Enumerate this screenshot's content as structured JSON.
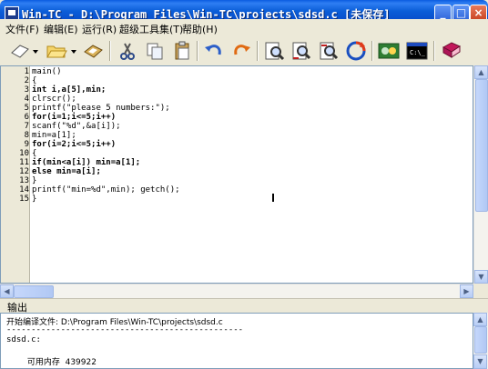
{
  "window": {
    "title": "Win-TC - D:\\Program Files\\Win-TC\\projects\\sdsd.c [未保存]",
    "controls": {
      "minimize": "_",
      "maximize": "□",
      "close": "×"
    }
  },
  "menu": {
    "items": [
      "文件(F)",
      "编辑(E)",
      "运行(R)",
      "超级工具集(T)",
      "帮助(H)"
    ]
  },
  "toolbar": {
    "icons": [
      "new-file-icon",
      "dropdown-arrow-icon",
      "open-folder-icon",
      "dropdown-arrow-icon",
      "save-icon",
      "cut-icon",
      "copy-icon",
      "paste-icon",
      "undo-icon",
      "redo-icon",
      "find-icon",
      "find-next-icon",
      "replace-icon",
      "refresh-icon",
      "compile-icon",
      "run-console-icon",
      "help-book-icon"
    ]
  },
  "editor": {
    "line_numbers": [
      "1",
      "2",
      "3",
      "4",
      "5",
      "6",
      "7",
      "8",
      "9",
      "10",
      "11",
      "12",
      "13",
      "14",
      "15"
    ],
    "lines": [
      "main()",
      "{",
      "int i,a[5],min;",
      "clrscr();",
      "printf(\"please 5 numbers:\");",
      "for(i=1;i<=5;i++)",
      "scanf(\"%d\",&a[i]);",
      "min=a[1];",
      "for(i=2;i<=5;i++)",
      "{",
      "if(min<a[i]) min=a[1];",
      "else min=a[i];",
      "}",
      "printf(\"min=%d\",min); getch();",
      "}"
    ]
  },
  "output": {
    "label": "输出",
    "lines": [
      "开始编译文件: D:\\Program Files\\Win-TC\\projects\\sdsd.c",
      "------------------------------------------------",
      "sdsd.c:",
      "",
      "        可用内存  439922"
    ]
  },
  "colors": {
    "titlebar": "#0b5ed8",
    "editor_bg": "#ffffff",
    "chrome": "#ece9d8"
  }
}
